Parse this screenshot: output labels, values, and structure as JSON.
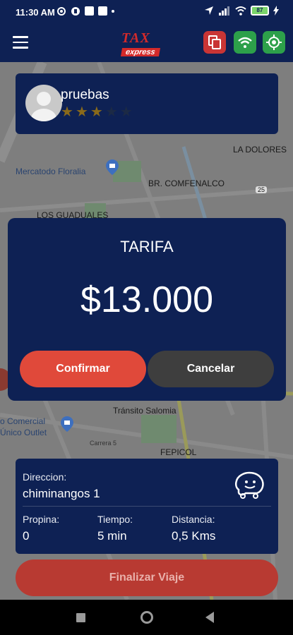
{
  "status_bar": {
    "time": "11:30 AM",
    "battery": "87"
  },
  "app_bar": {
    "logo_top": "TAX",
    "logo_bottom": "express"
  },
  "map": {
    "labels": [
      "LA DOLORES",
      "Mercatodo Floralia",
      "BR. COMFENALCO",
      "LOS GUADUALES",
      "Tránsito Salomia",
      "o Comercial",
      "Único Outlet",
      "Carrera 5",
      "FEPICOL",
      "25"
    ]
  },
  "driver": {
    "name": "pruebas",
    "rating": 3,
    "max_rating": 5
  },
  "fare": {
    "title": "TARIFA",
    "amount": "$13.000",
    "confirm_label": "Confirmar",
    "cancel_label": "Cancelar"
  },
  "trip": {
    "address_label": "Direccion:",
    "address_value": "chiminangos 1",
    "tip_label": "Propina:",
    "tip_value": "0",
    "time_label": "Tiempo:",
    "time_value": "5 min",
    "distance_label": "Distancia:",
    "distance_value": "0,5 Kms"
  },
  "finish_label": "Finalizar Viaje",
  "colors": {
    "navy": "#0e2154",
    "red": "#e0493a",
    "green": "#2da04a",
    "gray_button": "#3e3e3e",
    "star_gold": "#8a6a1a"
  }
}
